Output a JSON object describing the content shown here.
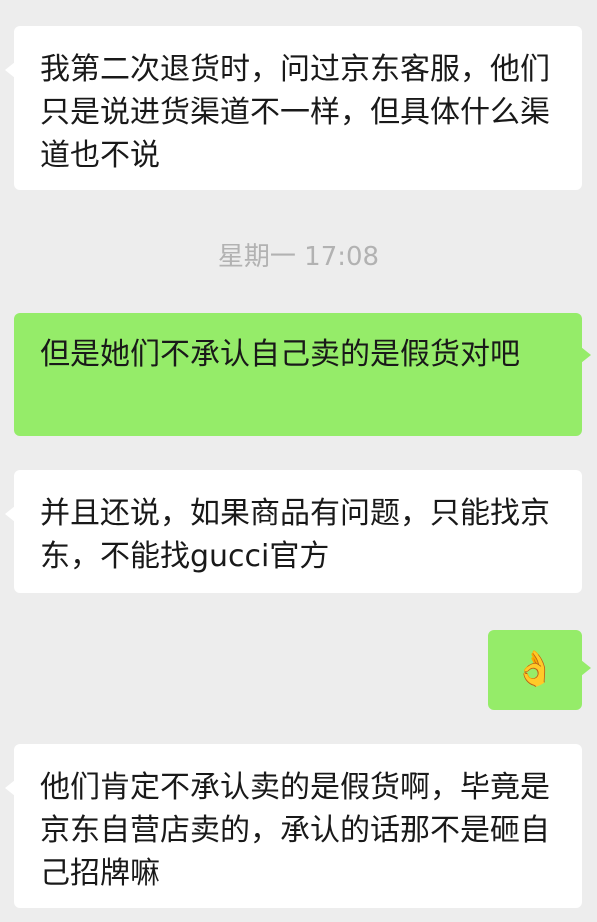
{
  "chat": {
    "messages": [
      {
        "side": "received",
        "text": "我第二次退货时，问过京东客服，他们只是说进货渠道不一样，但具体什么渠道也不说"
      },
      {
        "side": "sent",
        "text": "但是她们不承认自己卖的是假货对吧"
      },
      {
        "side": "received",
        "text": "并且还说，如果商品有问题，只能找京东，不能找gucci官方"
      },
      {
        "side": "sent",
        "text": "👌"
      },
      {
        "side": "received",
        "text": "他们肯定不承认卖的是假货啊，毕竟是京东自营店卖的，承认的话那不是砸自己招牌嘛"
      }
    ],
    "timestamp": "星期一 17:08"
  },
  "colors": {
    "background": "#ededed",
    "received_bubble": "#ffffff",
    "sent_bubble": "#95ec69",
    "timestamp_text": "#b2b2b2"
  }
}
